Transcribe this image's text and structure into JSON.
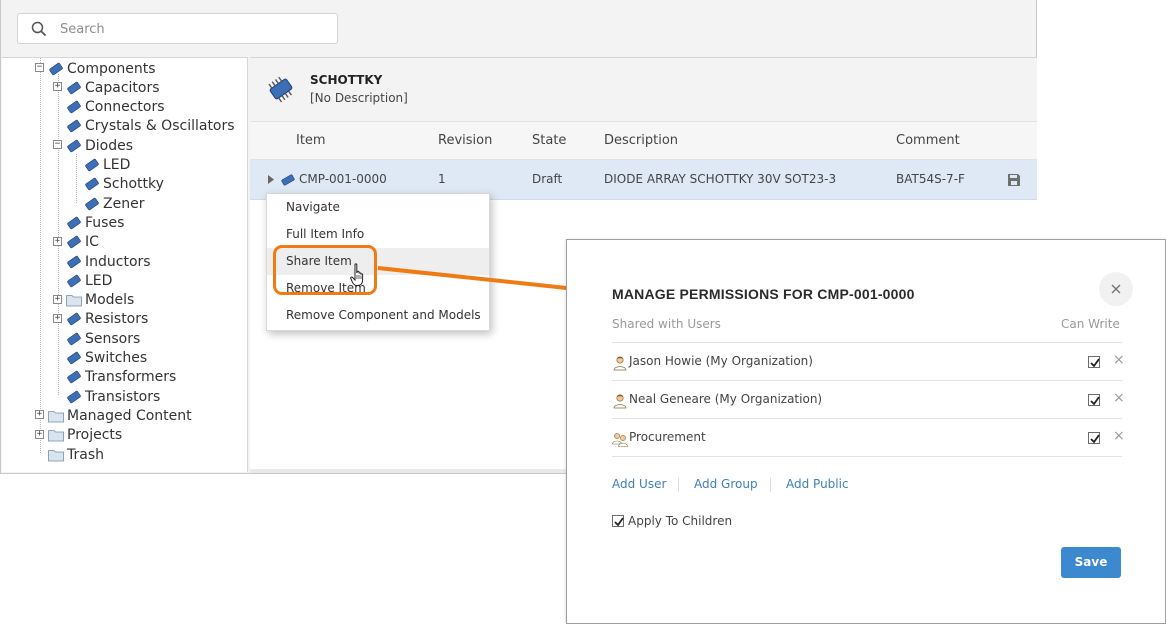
{
  "search": {
    "placeholder": "Search"
  },
  "tree": {
    "root": "Components",
    "items": [
      {
        "label": "Capacitors"
      },
      {
        "label": "Connectors"
      },
      {
        "label": "Crystals & Oscillators"
      },
      {
        "label": "Diodes",
        "children": [
          {
            "label": "LED"
          },
          {
            "label": "Schottky"
          },
          {
            "label": "Zener"
          }
        ]
      },
      {
        "label": "Fuses"
      },
      {
        "label": "IC"
      },
      {
        "label": "Inductors"
      },
      {
        "label": "LED"
      },
      {
        "label": "Models"
      },
      {
        "label": "Resistors"
      },
      {
        "label": "Sensors"
      },
      {
        "label": "Switches"
      },
      {
        "label": "Transformers"
      },
      {
        "label": "Transistors"
      }
    ],
    "top_level": [
      {
        "label": "Managed Content"
      },
      {
        "label": "Projects"
      },
      {
        "label": "Trash"
      }
    ]
  },
  "detail": {
    "title": "SCHOTTKY",
    "description": "[No Description]",
    "columns": {
      "item": "Item",
      "revision": "Revision",
      "state": "State",
      "description": "Description",
      "comment": "Comment"
    },
    "row": {
      "item": "CMP-001-0000",
      "revision": "1",
      "state": "Draft",
      "description": "DIODE ARRAY SCHOTTKY 30V SOT23-3",
      "comment": "BAT54S-7-F"
    }
  },
  "context_menu": {
    "items": [
      {
        "label": "Navigate"
      },
      {
        "label": "Full Item Info"
      },
      {
        "label": "Share Item"
      },
      {
        "label": "Remove Item"
      },
      {
        "label": "Remove Component and Models"
      }
    ]
  },
  "dialog": {
    "title": "MANAGE PERMISSIONS FOR CMP-001-0000",
    "shared_with_header": "Shared with Users",
    "can_write_header": "Can Write",
    "users": [
      {
        "name": "Jason Howie (My Organization)",
        "can_write": true,
        "type": "user"
      },
      {
        "name": "Neal Geneare (My Organization)",
        "can_write": true,
        "type": "user"
      },
      {
        "name": "Procurement",
        "can_write": true,
        "type": "group"
      }
    ],
    "add_user": "Add User",
    "add_group": "Add Group",
    "add_public": "Add Public",
    "apply_to_children": "Apply To Children",
    "save": "Save"
  },
  "colors": {
    "accent": "#f07a14",
    "link": "#3e7fb8",
    "primary_button": "#3d89cf",
    "selected_row": "#dfe9f5"
  }
}
